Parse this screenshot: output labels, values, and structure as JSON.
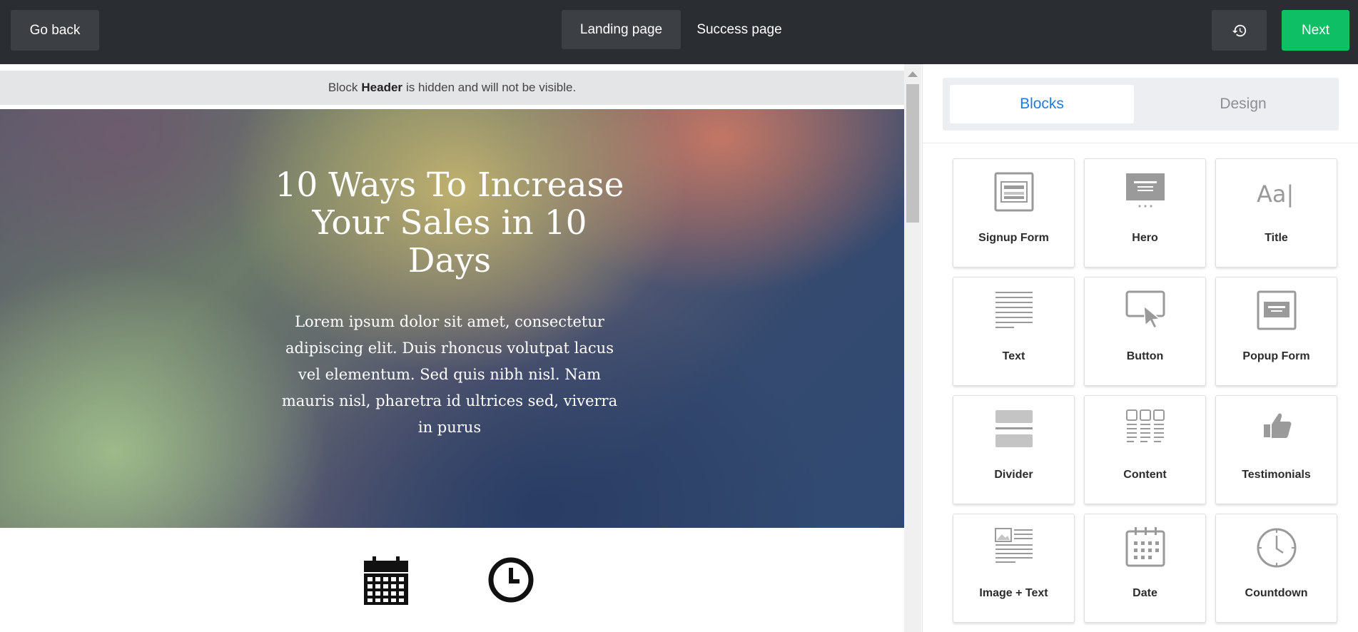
{
  "topbar": {
    "go_back": "Go back",
    "tabs": [
      {
        "label": "Landing page",
        "active": true
      },
      {
        "label": "Success page",
        "active": false
      }
    ],
    "next": "Next",
    "history_icon": "history-icon"
  },
  "canvas": {
    "notice_prefix": "Block",
    "notice_block": "Header",
    "notice_suffix": "is hidden and will not be visible.",
    "hero_title": "10 Ways To Increase Your Sales in 10 Days",
    "hero_text": "Lorem ipsum dolor sit amet, consectetur adipiscing elit. Duis rhoncus volutpat lacus vel elementum. Sed quis nibh nisl. Nam mauris nisl, pharetra id ultrices sed, viverra in purus",
    "icons": [
      "calendar-icon",
      "clock-icon"
    ]
  },
  "sidebar": {
    "tabs": [
      {
        "label": "Blocks",
        "active": true
      },
      {
        "label": "Design",
        "active": false
      }
    ],
    "blocks": [
      {
        "label": "Signup Form",
        "icon": "signup-form-icon"
      },
      {
        "label": "Hero",
        "icon": "hero-icon"
      },
      {
        "label": "Title",
        "icon": "title-icon"
      },
      {
        "label": "Text",
        "icon": "text-icon"
      },
      {
        "label": "Button",
        "icon": "button-icon"
      },
      {
        "label": "Popup Form",
        "icon": "popup-form-icon"
      },
      {
        "label": "Divider",
        "icon": "divider-icon"
      },
      {
        "label": "Content",
        "icon": "content-icon"
      },
      {
        "label": "Testimonials",
        "icon": "thumbs-up-icon"
      },
      {
        "label": "Image + Text",
        "icon": "image-text-icon"
      },
      {
        "label": "Date",
        "icon": "date-icon"
      },
      {
        "label": "Countdown",
        "icon": "countdown-icon"
      }
    ],
    "title_icon_text": "Aa|"
  },
  "colors": {
    "accent_blue": "#1e7cdf",
    "next_green": "#0fbf65",
    "topbar": "#2a2d32"
  }
}
